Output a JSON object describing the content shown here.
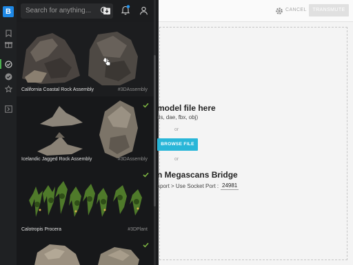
{
  "rail": {
    "logo_letter": "B",
    "icons": [
      "bookmark-icon",
      "gift-icon",
      "check-circle-outline-icon",
      "check-circle-filled-icon",
      "star-icon",
      "exit-icon"
    ],
    "accent": "#4caf50"
  },
  "panel": {
    "search": {
      "placeholder": "Search for anything...",
      "value": ""
    },
    "cards": [
      {
        "name": "California Coastal Rock Assembly",
        "tag": "#3DAssembly",
        "checked": false
      },
      {
        "name": "Icelandic Jagged Rock Assembly",
        "tag": "#3DAssembly",
        "checked": true
      },
      {
        "name": "Calotropis Procera",
        "tag": "#3DPlant",
        "checked": true
      },
      {
        "name": "",
        "tag": "",
        "checked": true
      }
    ],
    "check_color": "#7cb342"
  },
  "header": {
    "cancel_label": "CANCEL",
    "transmute_label": "TRANSMUTE"
  },
  "main": {
    "drop_title": "model file here",
    "drop_formats": "ds, dae, fbx, obj)",
    "or_1": "or",
    "browse_label": "BROWSE FILE",
    "or_2": "or",
    "bridge_title": "n Megascans Bridge",
    "bridge_hint": "xport > Use Socket Port :",
    "port_value": "24981",
    "browse_color": "#29b6d8"
  }
}
